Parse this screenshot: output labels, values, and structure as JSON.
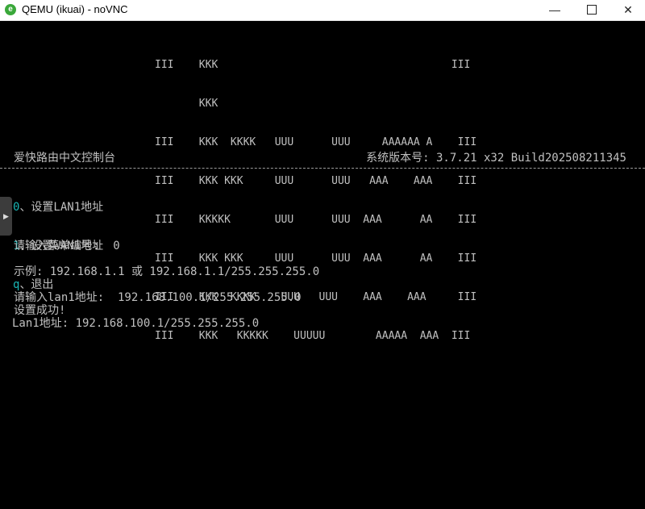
{
  "window": {
    "title": "QEMU (ikuai) - noVNC",
    "icon": "e-browser-icon",
    "controls": {
      "minimize": "—",
      "close": "✕"
    }
  },
  "console": {
    "logo_lines": [
      "III    KKK                                     III",
      "       KKK",
      "III    KKK  KKKK   UUU      UUU     AAAAAA A    III",
      "III    KKK KKK     UUU      UUU   AAA    AAA    III",
      "III    KKKKK       UUU      UUU  AAA      AA    III",
      "III    KKK KKK     UUU      UUU  AAA      AA    III",
      "III    KKK  KKKK    UUU   UUU    AAA    AAA     III",
      "III    KKK   KKKKK    UUUUU        AAAAA  AAA  III"
    ],
    "header_left": "爱快路由中文控制台",
    "header_right": "系统版本号: 3.7.21 x32 Build202508211345",
    "menu": [
      {
        "key": "0",
        "label": "、设置LAN1地址"
      },
      {
        "key": "1",
        "label": "、设置WAN1地址"
      },
      {
        "key": "q",
        "label": "、退出"
      }
    ],
    "prompt_menu": "请输入菜单编号:  0",
    "example": "示例: 192.168.1.1 或 192.168.1.1/255.255.255.0",
    "prompt_lan": "请输入lan1地址:  192.168.100.1/255.255.255.0",
    "success": "设置成功!",
    "result": "Lan1地址: 192.168.100.1/255.255.255.0"
  },
  "side_handle": "▶"
}
